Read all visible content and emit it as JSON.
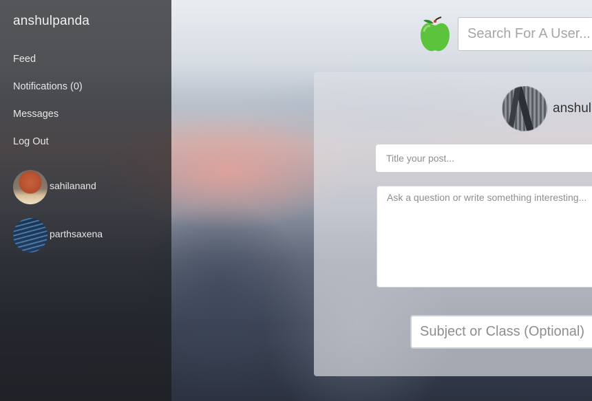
{
  "sidebar": {
    "username": "anshulpanda",
    "nav": [
      {
        "label": "Feed"
      },
      {
        "label": "Notifications (0)"
      },
      {
        "label": "Messages"
      },
      {
        "label": "Log Out"
      }
    ],
    "friends": [
      {
        "name": "sahilanand",
        "avatar": "basketball-photo"
      },
      {
        "name": "parthsaxena",
        "avatar": "code-screen-photo"
      }
    ]
  },
  "header": {
    "logo_icon": "green-apple-icon",
    "search_placeholder": "Search For A User..."
  },
  "composer": {
    "username": "anshul",
    "avatar": "skyscrapers-photo",
    "title_placeholder": "Title your post...",
    "body_placeholder": "Ask a question or write something interesting...",
    "subject_placeholder": "Subject or Class (Optional)"
  },
  "colors": {
    "apple_green": "#5cc43c",
    "sidebar_bg": "#1c1c1e"
  }
}
